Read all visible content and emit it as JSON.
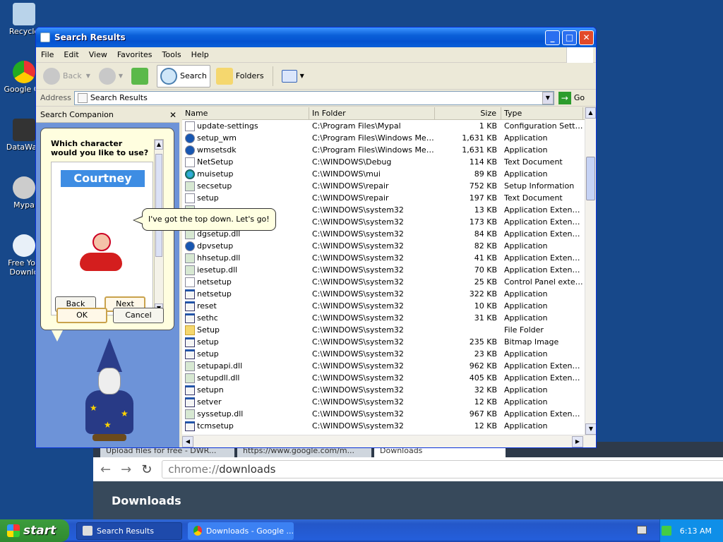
{
  "desktop": {
    "icons": [
      {
        "label": "Recycle"
      },
      {
        "label": "Google Ch"
      },
      {
        "label": "DataWag"
      },
      {
        "label": "Mypa"
      },
      {
        "label": "Free You Downlo"
      }
    ]
  },
  "chrome": {
    "tabs": [
      "Upload files for free - DWR...",
      "https://www.google.com/m...",
      "Downloads"
    ],
    "url_scheme": "chrome://",
    "url_path": "downloads",
    "page_heading": "Downloads"
  },
  "window": {
    "title": "Search Results",
    "menu": [
      "File",
      "Edit",
      "View",
      "Favorites",
      "Tools",
      "Help"
    ],
    "toolbar": {
      "back": "Back",
      "search": "Search",
      "folders": "Folders"
    },
    "address": {
      "label": "Address",
      "value": "Search Results",
      "go": "Go"
    }
  },
  "companion": {
    "header": "Search Companion",
    "close": "✕",
    "question": "Which character would you like to use?",
    "character_name": "Courtney",
    "tooltip": "I've got the top down. Let's go!",
    "back": "Back",
    "next": "Next",
    "ok": "OK",
    "cancel": "Cancel"
  },
  "list": {
    "columns": [
      "Name",
      "In Folder",
      "Size",
      "Type"
    ],
    "rows": [
      {
        "name": "update-settings",
        "folder": "C:\\Program Files\\Mypal",
        "size": "1 KB",
        "type": "Configuration Settings",
        "icon": "doc"
      },
      {
        "name": "setup_wm",
        "folder": "C:\\Program Files\\Windows Medi...",
        "size": "1,631 KB",
        "type": "Application",
        "icon": "disc"
      },
      {
        "name": "wmsetsdk",
        "folder": "C:\\Program Files\\Windows Medi...",
        "size": "1,631 KB",
        "type": "Application",
        "icon": "disc"
      },
      {
        "name": "NetSetup",
        "folder": "C:\\WINDOWS\\Debug",
        "size": "114 KB",
        "type": "Text Document",
        "icon": "doc"
      },
      {
        "name": "muisetup",
        "folder": "C:\\WINDOWS\\mui",
        "size": "89 KB",
        "type": "Application",
        "icon": "globe"
      },
      {
        "name": "secsetup",
        "folder": "C:\\WINDOWS\\repair",
        "size": "752 KB",
        "type": "Setup Information",
        "icon": "dll"
      },
      {
        "name": "setup",
        "folder": "C:\\WINDOWS\\repair",
        "size": "197 KB",
        "type": "Text Document",
        "icon": "doc"
      },
      {
        "name": "",
        "folder": "C:\\WINDOWS\\system32",
        "size": "13 KB",
        "type": "Application Extension",
        "icon": "dll"
      },
      {
        "name": "",
        "folder": "C:\\WINDOWS\\system32",
        "size": "173 KB",
        "type": "Application Extension",
        "icon": "dll"
      },
      {
        "name": "dgsetup.dll",
        "folder": "C:\\WINDOWS\\system32",
        "size": "84 KB",
        "type": "Application Extension",
        "icon": "dll"
      },
      {
        "name": "dpvsetup",
        "folder": "C:\\WINDOWS\\system32",
        "size": "82 KB",
        "type": "Application",
        "icon": "disc"
      },
      {
        "name": "hhsetup.dll",
        "folder": "C:\\WINDOWS\\system32",
        "size": "41 KB",
        "type": "Application Extension",
        "icon": "dll"
      },
      {
        "name": "iesetup.dll",
        "folder": "C:\\WINDOWS\\system32",
        "size": "70 KB",
        "type": "Application Extension",
        "icon": "dll"
      },
      {
        "name": "netsetup",
        "folder": "C:\\WINDOWS\\system32",
        "size": "25 KB",
        "type": "Control Panel exten...",
        "icon": "doc"
      },
      {
        "name": "netsetup",
        "folder": "C:\\WINDOWS\\system32",
        "size": "322 KB",
        "type": "Application",
        "icon": "app"
      },
      {
        "name": "reset",
        "folder": "C:\\WINDOWS\\system32",
        "size": "10 KB",
        "type": "Application",
        "icon": "app"
      },
      {
        "name": "sethc",
        "folder": "C:\\WINDOWS\\system32",
        "size": "31 KB",
        "type": "Application",
        "icon": "app"
      },
      {
        "name": "Setup",
        "folder": "C:\\WINDOWS\\system32",
        "size": "",
        "type": "File Folder",
        "icon": "folder"
      },
      {
        "name": "setup",
        "folder": "C:\\WINDOWS\\system32",
        "size": "235 KB",
        "type": "Bitmap Image",
        "icon": "app"
      },
      {
        "name": "setup",
        "folder": "C:\\WINDOWS\\system32",
        "size": "23 KB",
        "type": "Application",
        "icon": "app"
      },
      {
        "name": "setupapi.dll",
        "folder": "C:\\WINDOWS\\system32",
        "size": "962 KB",
        "type": "Application Extension",
        "icon": "dll"
      },
      {
        "name": "setupdll.dll",
        "folder": "C:\\WINDOWS\\system32",
        "size": "405 KB",
        "type": "Application Extension",
        "icon": "dll"
      },
      {
        "name": "setupn",
        "folder": "C:\\WINDOWS\\system32",
        "size": "32 KB",
        "type": "Application",
        "icon": "app"
      },
      {
        "name": "setver",
        "folder": "C:\\WINDOWS\\system32",
        "size": "12 KB",
        "type": "Application",
        "icon": "app"
      },
      {
        "name": "syssetup.dll",
        "folder": "C:\\WINDOWS\\system32",
        "size": "967 KB",
        "type": "Application Extension",
        "icon": "dll"
      },
      {
        "name": "tcmsetup",
        "folder": "C:\\WINDOWS\\system32",
        "size": "12 KB",
        "type": "Application",
        "icon": "app"
      }
    ]
  },
  "taskbar": {
    "start": "start",
    "tasks": [
      "Search Results",
      "Downloads - Google ..."
    ],
    "clock": "6:13 AM"
  },
  "colors": {
    "titlebar": "#0a5fd8",
    "pane": "#6d93d8",
    "taskbar": "#245edb",
    "start": "#2f8a2f"
  }
}
